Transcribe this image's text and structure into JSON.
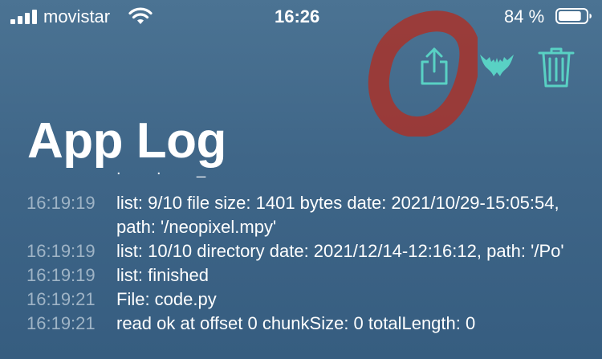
{
  "status_bar": {
    "carrier": "movistar",
    "time": "16:26",
    "battery_percent": "84 %",
    "battery_level": 0.84,
    "signal_bars": 4
  },
  "toolbar": {
    "share_icon": "share-icon",
    "bat_icon": "bat-icon",
    "trash_icon": "trash-icon",
    "accent_color": "#59d1c4",
    "annotation_color": "#a8322a"
  },
  "page": {
    "title": "App Log",
    "cut_off_text": ".        .        _"
  },
  "log": [
    {
      "time": "16:19:19",
      "message": "list: 9/10 file size: 1401 bytes date: 2021/10/29-15:05:54, path: '/neopixel.mpy'"
    },
    {
      "time": "16:19:19",
      "message": "list: 10/10 directory date: 2021/12/14-12:16:12, path: '/Po'"
    },
    {
      "time": "16:19:19",
      "message": "list: finished"
    },
    {
      "time": "16:19:21",
      "message": "File: code.py"
    },
    {
      "time": "16:19:21",
      "message": "read ok at offset 0 chunkSize: 0 totalLength: 0"
    }
  ]
}
